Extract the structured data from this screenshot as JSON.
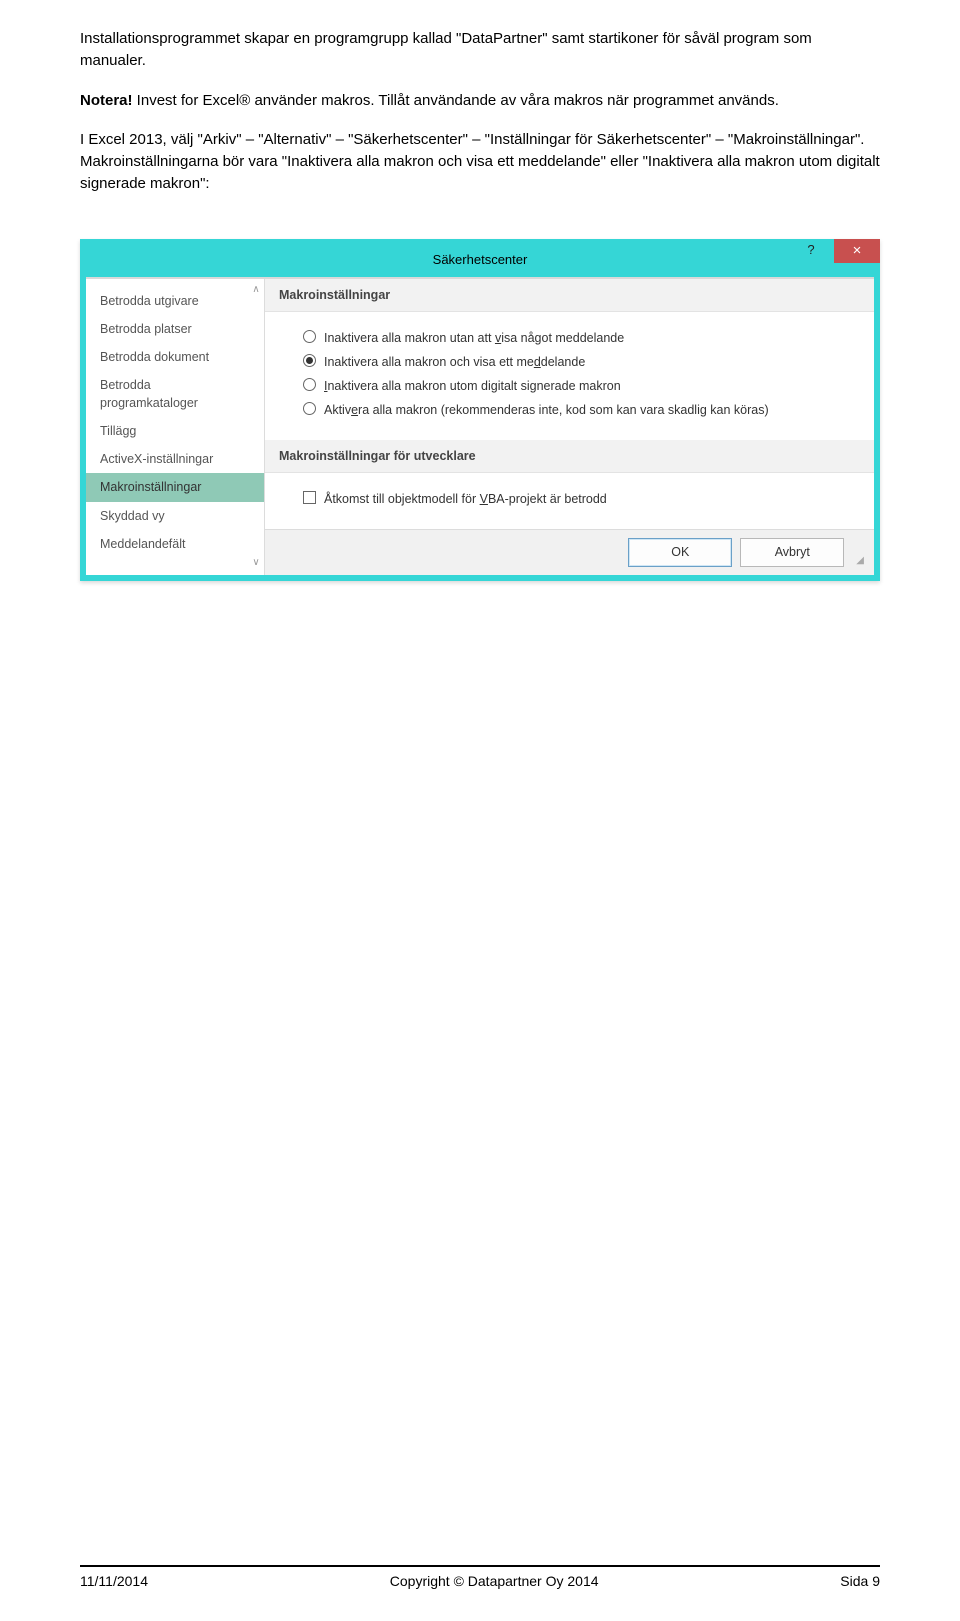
{
  "intro": {
    "para1": "Installationsprogrammet skapar en programgrupp kallad \"DataPartner\" samt startikoner för såväl program som manualer."
  },
  "notice": {
    "label": "Notera!",
    "text": " Invest for Excel® använder makros. Tillåt användande av våra makros när programmet används."
  },
  "body": {
    "para1": "I Excel 2013, välj \"Arkiv\" – \"Alternativ\" – \"Säkerhetscenter\" – \"Inställningar för Säkerhetscenter\" – \"Makroinställningar\". Makroinställningarna bör vara \"Inaktivera alla makron och visa ett meddelande\" eller \"Inaktivera alla makron utom digitalt signerade makron\":"
  },
  "dialog": {
    "title": "Säkerhetscenter",
    "help": "?",
    "close": "×",
    "nav": [
      {
        "label": "Betrodda utgivare",
        "selected": false
      },
      {
        "label": "Betrodda platser",
        "selected": false
      },
      {
        "label": "Betrodda dokument",
        "selected": false
      },
      {
        "label": "Betrodda programkataloger",
        "selected": false
      },
      {
        "label": "Tillägg",
        "selected": false
      },
      {
        "label": "ActiveX-inställningar",
        "selected": false
      },
      {
        "label": "Makroinställningar",
        "selected": true
      },
      {
        "label": "Skyddad vy",
        "selected": false
      },
      {
        "label": "Meddelandefält",
        "selected": false
      }
    ],
    "section1_head": "Makroinställningar",
    "radios": [
      {
        "pre": "Inaktivera alla makron utan att ",
        "u": "v",
        "post": "isa något meddelande",
        "checked": false
      },
      {
        "pre": "Inaktivera alla makron och visa ett me",
        "u": "d",
        "post": "delande",
        "checked": true
      },
      {
        "pre": "",
        "u": "I",
        "post": "naktivera alla makron utom digitalt signerade makron",
        "checked": false
      },
      {
        "pre": "Aktiv",
        "u": "e",
        "post": "ra alla makron (rekommenderas inte, kod som kan vara skadlig kan köras)",
        "checked": false
      }
    ],
    "section2_head": "Makroinställningar för utvecklare",
    "checkbox": {
      "pre": "Åtkomst till objektmodell för ",
      "u": "V",
      "post": "BA-projekt är betrodd",
      "checked": false
    },
    "buttons": {
      "ok": "OK",
      "cancel": "Avbryt"
    }
  },
  "footer": {
    "date": "11/11/2014",
    "copyright": "Copyright © Datapartner Oy 2014",
    "page": "Sida 9"
  }
}
